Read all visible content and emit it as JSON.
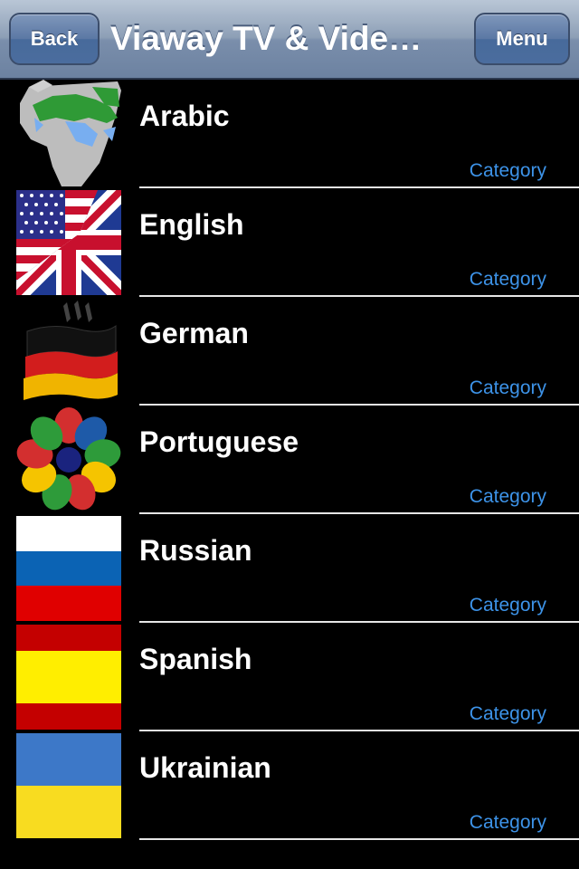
{
  "header": {
    "back_label": "Back",
    "title": "Viaway TV & Vide…",
    "menu_label": "Menu"
  },
  "languages": [
    {
      "name": "Arabic",
      "sub": "Category",
      "flag_icon": "arab-world-map-icon"
    },
    {
      "name": "English",
      "sub": "Category",
      "flag_icon": "us-uk-flag-icon"
    },
    {
      "name": "German",
      "sub": "Category",
      "flag_icon": "germany-flag-icon"
    },
    {
      "name": "Portuguese",
      "sub": "Category",
      "flag_icon": "lusophone-flags-icon"
    },
    {
      "name": "Russian",
      "sub": "Category",
      "flag_icon": "russia-flag-icon"
    },
    {
      "name": "Spanish",
      "sub": "Category",
      "flag_icon": "spain-flag-icon"
    },
    {
      "name": "Ukrainian",
      "sub": "Category",
      "flag_icon": "ukraine-flag-icon"
    }
  ],
  "colors": {
    "accent": "#3d93e8",
    "navbar": "#7a8eab",
    "background": "#000000"
  }
}
